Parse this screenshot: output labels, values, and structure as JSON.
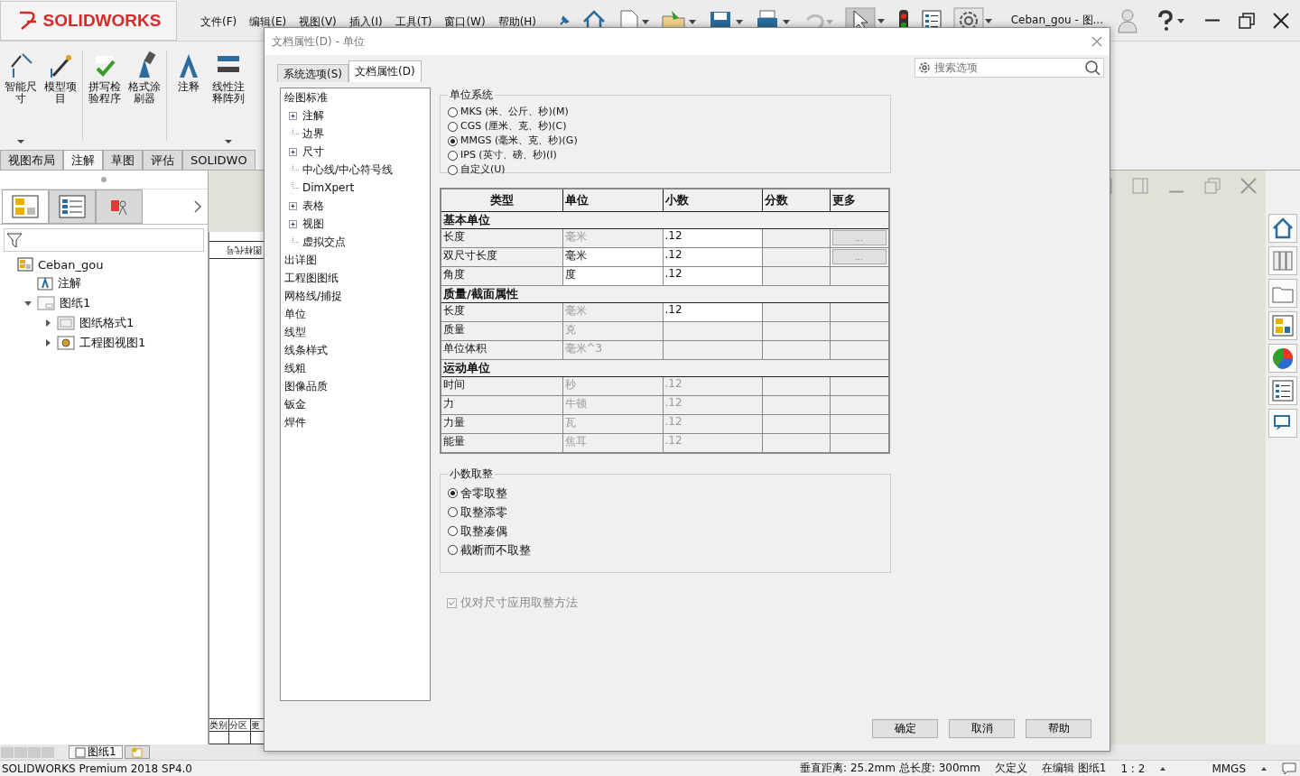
{
  "app": {
    "logo": "SOLIDWORKS",
    "menu": [
      "文件(F)",
      "编辑(E)",
      "视图(V)",
      "插入(I)",
      "工具(T)",
      "窗口(W)",
      "帮助(H)"
    ],
    "document_title": "Ceban_gou - 图..."
  },
  "ribbon": {
    "commands": [
      {
        "label": "智能尺寸",
        "menu": true
      },
      {
        "label": "模型项目",
        "menu": false
      },
      {
        "label": "拼写检验程序",
        "menu": false
      },
      {
        "label": "格式涂刷器",
        "menu": false
      },
      {
        "label": "注释",
        "menu": false
      },
      {
        "label": "线性注释阵列",
        "menu": true
      }
    ],
    "tabs": [
      {
        "label": "视图布局",
        "selected": false
      },
      {
        "label": "注解",
        "selected": true
      },
      {
        "label": "草图",
        "selected": false
      },
      {
        "label": "评估",
        "selected": false
      },
      {
        "label": "SOLIDWO",
        "selected": false
      }
    ]
  },
  "feature_manager": {
    "tabs": [
      {
        "selected": true
      },
      {
        "selected": false
      },
      {
        "selected": false
      }
    ],
    "tree": [
      {
        "label": "Ceban_gou",
        "kind": "document",
        "children": [
          {
            "label": "注解",
            "kind": "annotations"
          },
          {
            "label": "图纸1",
            "kind": "sheet",
            "expanded": true,
            "children": [
              {
                "label": "图纸格式1",
                "kind": "sheet-format",
                "expanded": false
              },
              {
                "label": "工程图视图1",
                "kind": "drawing-view",
                "expanded": false
              }
            ]
          }
        ]
      }
    ]
  },
  "sheet": {
    "corner_label": "图样代号",
    "table_headers": [
      "类别",
      "分区",
      "更"
    ]
  },
  "sheet_tabs": [
    {
      "label": "图纸1",
      "selected": true
    }
  ],
  "status_bar": {
    "product": "SOLIDWORKS Premium 2018 SP4.0",
    "measure": "垂直距离: 25.2mm 总长度: 300mm",
    "state": "欠定义",
    "editing": "在编辑 图纸1",
    "scale": "1 : 2",
    "units": "MMGS"
  },
  "dialog": {
    "title": "文档属性(D) - 单位",
    "tabs": [
      {
        "label": "系统选项(S)",
        "selected": false
      },
      {
        "label": "文档属性(D)",
        "selected": true
      }
    ],
    "search": {
      "placeholder": "搜索选项"
    },
    "nav": [
      {
        "label": "绘图标准",
        "children": [
          {
            "label": "注解",
            "expandable": true
          },
          {
            "label": "边界",
            "expandable": false
          },
          {
            "label": "尺寸",
            "expandable": true
          },
          {
            "label": "中心线/中心符号线",
            "expandable": false
          },
          {
            "label": "DimXpert",
            "expandable": false
          },
          {
            "label": "表格",
            "expandable": true
          },
          {
            "label": "视图",
            "expandable": true
          },
          {
            "label": "虚拟交点",
            "expandable": false
          }
        ]
      },
      {
        "label": "出详图"
      },
      {
        "label": "工程图图纸"
      },
      {
        "label": "网格线/捕捉"
      },
      {
        "label": "单位"
      },
      {
        "label": "线型"
      },
      {
        "label": "线条样式"
      },
      {
        "label": "线粗"
      },
      {
        "label": "图像品质"
      },
      {
        "label": "钣金"
      },
      {
        "label": "焊件"
      }
    ],
    "unit_system": {
      "title": "单位系统",
      "options": [
        {
          "label": "MKS (米、公斤、秒)(M)",
          "selected": false
        },
        {
          "label": "CGS (厘米、克、秒)(C)",
          "selected": false
        },
        {
          "label": "MMGS (毫米、克、秒)(G)",
          "selected": true
        },
        {
          "label": "IPS (英寸、磅、秒)(I)",
          "selected": false
        },
        {
          "label": "自定义(U)",
          "selected": false
        }
      ]
    },
    "table": {
      "columns": [
        "类型",
        "单位",
        "小数",
        "分数",
        "更多"
      ],
      "rows": [
        {
          "kind": "section",
          "label": "基本单位"
        },
        {
          "kind": "row",
          "label": "长度",
          "unit": "毫米",
          "unit_enabled": false,
          "decimal": ".12",
          "decimal_enabled": true,
          "more": "..."
        },
        {
          "kind": "row",
          "label": "双尺寸长度",
          "unit": "毫米",
          "unit_enabled": true,
          "decimal": ".12",
          "decimal_enabled": true,
          "more": "..."
        },
        {
          "kind": "row",
          "label": "角度",
          "unit": "度",
          "unit_enabled": true,
          "decimal": ".12",
          "decimal_enabled": true
        },
        {
          "kind": "section",
          "label": "质量/截面属性"
        },
        {
          "kind": "row",
          "label": "长度",
          "unit": "毫米",
          "unit_enabled": false,
          "decimal": ".12",
          "decimal_enabled": true
        },
        {
          "kind": "row",
          "label": "质量",
          "unit": "克",
          "unit_enabled": false
        },
        {
          "kind": "row",
          "label": "单位体积",
          "unit": "毫米^3",
          "unit_enabled": false
        },
        {
          "kind": "section",
          "label": "运动单位"
        },
        {
          "kind": "row",
          "label": "时间",
          "unit": "秒",
          "unit_enabled": false,
          "decimal": ".12",
          "decimal_enabled": false
        },
        {
          "kind": "row",
          "label": "力",
          "unit": "牛顿",
          "unit_enabled": false,
          "decimal": ".12",
          "decimal_enabled": false
        },
        {
          "kind": "row",
          "label": "力量",
          "unit": "瓦",
          "unit_enabled": false,
          "decimal": ".12",
          "decimal_enabled": false
        },
        {
          "kind": "row",
          "label": "能量",
          "unit": "焦耳",
          "unit_enabled": false,
          "decimal": ".12",
          "decimal_enabled": false
        }
      ]
    },
    "rounding": {
      "title": "小数取整",
      "options": [
        {
          "label": "舍零取整",
          "selected": true
        },
        {
          "label": "取整添零",
          "selected": false
        },
        {
          "label": "取整凑偶",
          "selected": false
        },
        {
          "label": "截断而不取整",
          "selected": false
        }
      ]
    },
    "apply_only_dimensions": {
      "label": "仅对尺寸应用取整方法",
      "checked": true,
      "disabled": true
    },
    "buttons": [
      "确定",
      "取消",
      "帮助"
    ]
  }
}
